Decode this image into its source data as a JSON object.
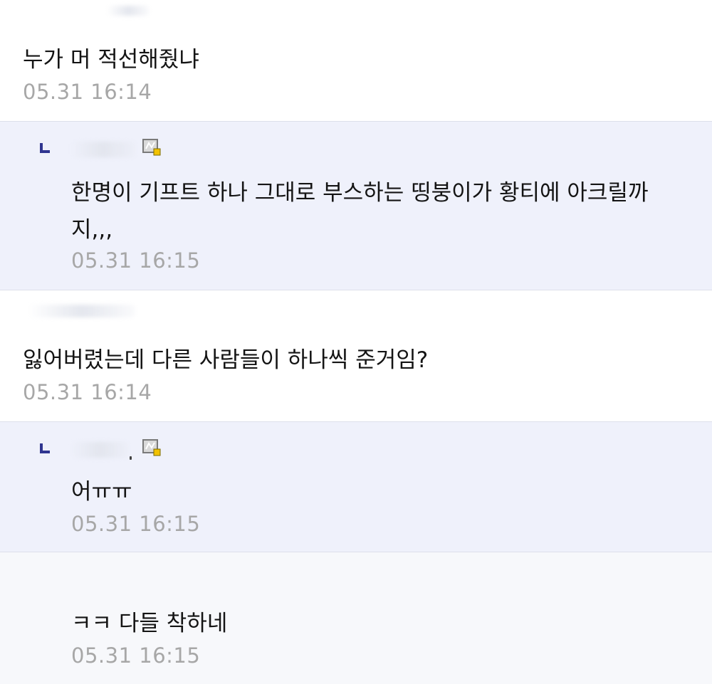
{
  "comments": [
    {
      "text": "누가 머 적선해줬냐",
      "time": "05.31 16:14"
    },
    {
      "text": "한명이 기프트 하나 그대로 부스하는 띵붕이가 황티에 아크릴까\n지,,,",
      "time": "05.31 16:15",
      "grade_icon": "user-grade-icon"
    },
    {
      "text": "잃어버렸는데 다른 사람들이 하나씩 준거임?",
      "time": "05.31 16:14"
    },
    {
      "text": "어ㅠㅠ",
      "time": "05.31 16:15",
      "grade_icon": "user-grade-icon"
    },
    {
      "text": "ㅋㅋ 다들 착하네",
      "time": "05.31 16:15"
    }
  ],
  "colors": {
    "reply_background": "#eff1fb",
    "reply_marker": "#2f3590",
    "timestamp": "#a7a7a7",
    "grade_badge": "#f2c200"
  }
}
